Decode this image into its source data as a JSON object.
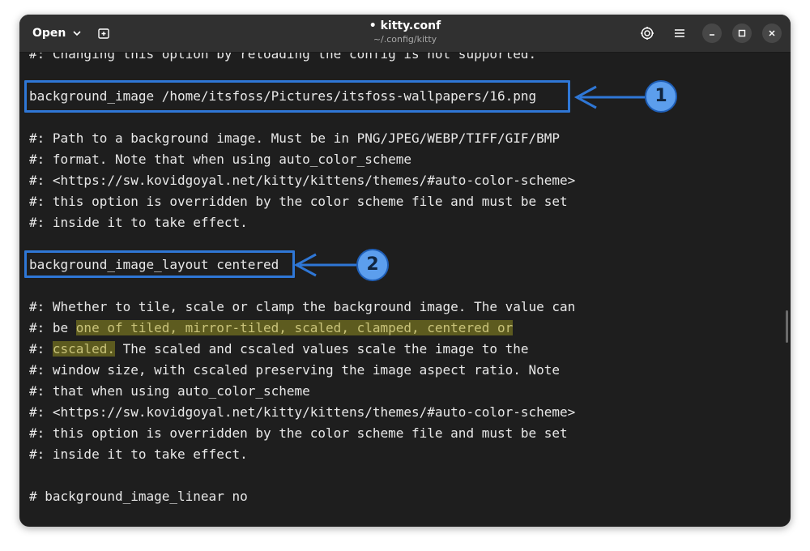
{
  "header": {
    "open_label": "Open",
    "title": "• kitty.conf",
    "subtitle": "~/.config/kitty"
  },
  "icons": {
    "chevron": "chevron-down-icon",
    "new_tab": "new-tab-icon",
    "settings": "settings-icon",
    "menu": "hamburger-menu-icon",
    "minimize": "minimize-icon",
    "maximize": "maximize-icon",
    "close": "close-icon"
  },
  "editor": {
    "lines": [
      "#: Changing this option by reloading the config is not supported.",
      "",
      "background_image /home/itsfoss/Pictures/itsfoss-wallpapers/16.png",
      "",
      "#: Path to a background image. Must be in PNG/JPEG/WEBP/TIFF/GIF/BMP",
      "#: format. Note that when using auto_color_scheme",
      "#: <https://sw.kovidgoyal.net/kitty/kittens/themes/#auto-color-scheme>",
      "#: this option is overridden by the color scheme file and must be set",
      "#: inside it to take effect.",
      "",
      "background_image_layout centered",
      "",
      "#: Whether to tile, scale or clamp the background image. The value can",
      "",
      "",
      "#: window size, with cscaled preserving the image aspect ratio. Note",
      "#: that when using auto_color_scheme",
      "#: <https://sw.kovidgoyal.net/kitty/kittens/themes/#auto-color-scheme>",
      "#: this option is overridden by the color scheme file and must be set",
      "#: inside it to take effect.",
      "",
      "# background_image_linear no"
    ],
    "line13_prefix": "#: be ",
    "line13_highlight": "one of tiled, mirror-tiled, scaled, clamped, centered or",
    "line14_prefix": "#: ",
    "line14_highlight": "cscaled.",
    "line14_rest": " The scaled and cscaled values scale the image to the"
  },
  "annotations": {
    "badge_1": "1",
    "badge_2": "2",
    "color": "#2f77d6",
    "badge_color": "#5c9eed"
  },
  "colors": {
    "editor_bg": "#1e1e1e",
    "header_bg": "#303030",
    "highlight_bg": "#5d5b1f"
  }
}
